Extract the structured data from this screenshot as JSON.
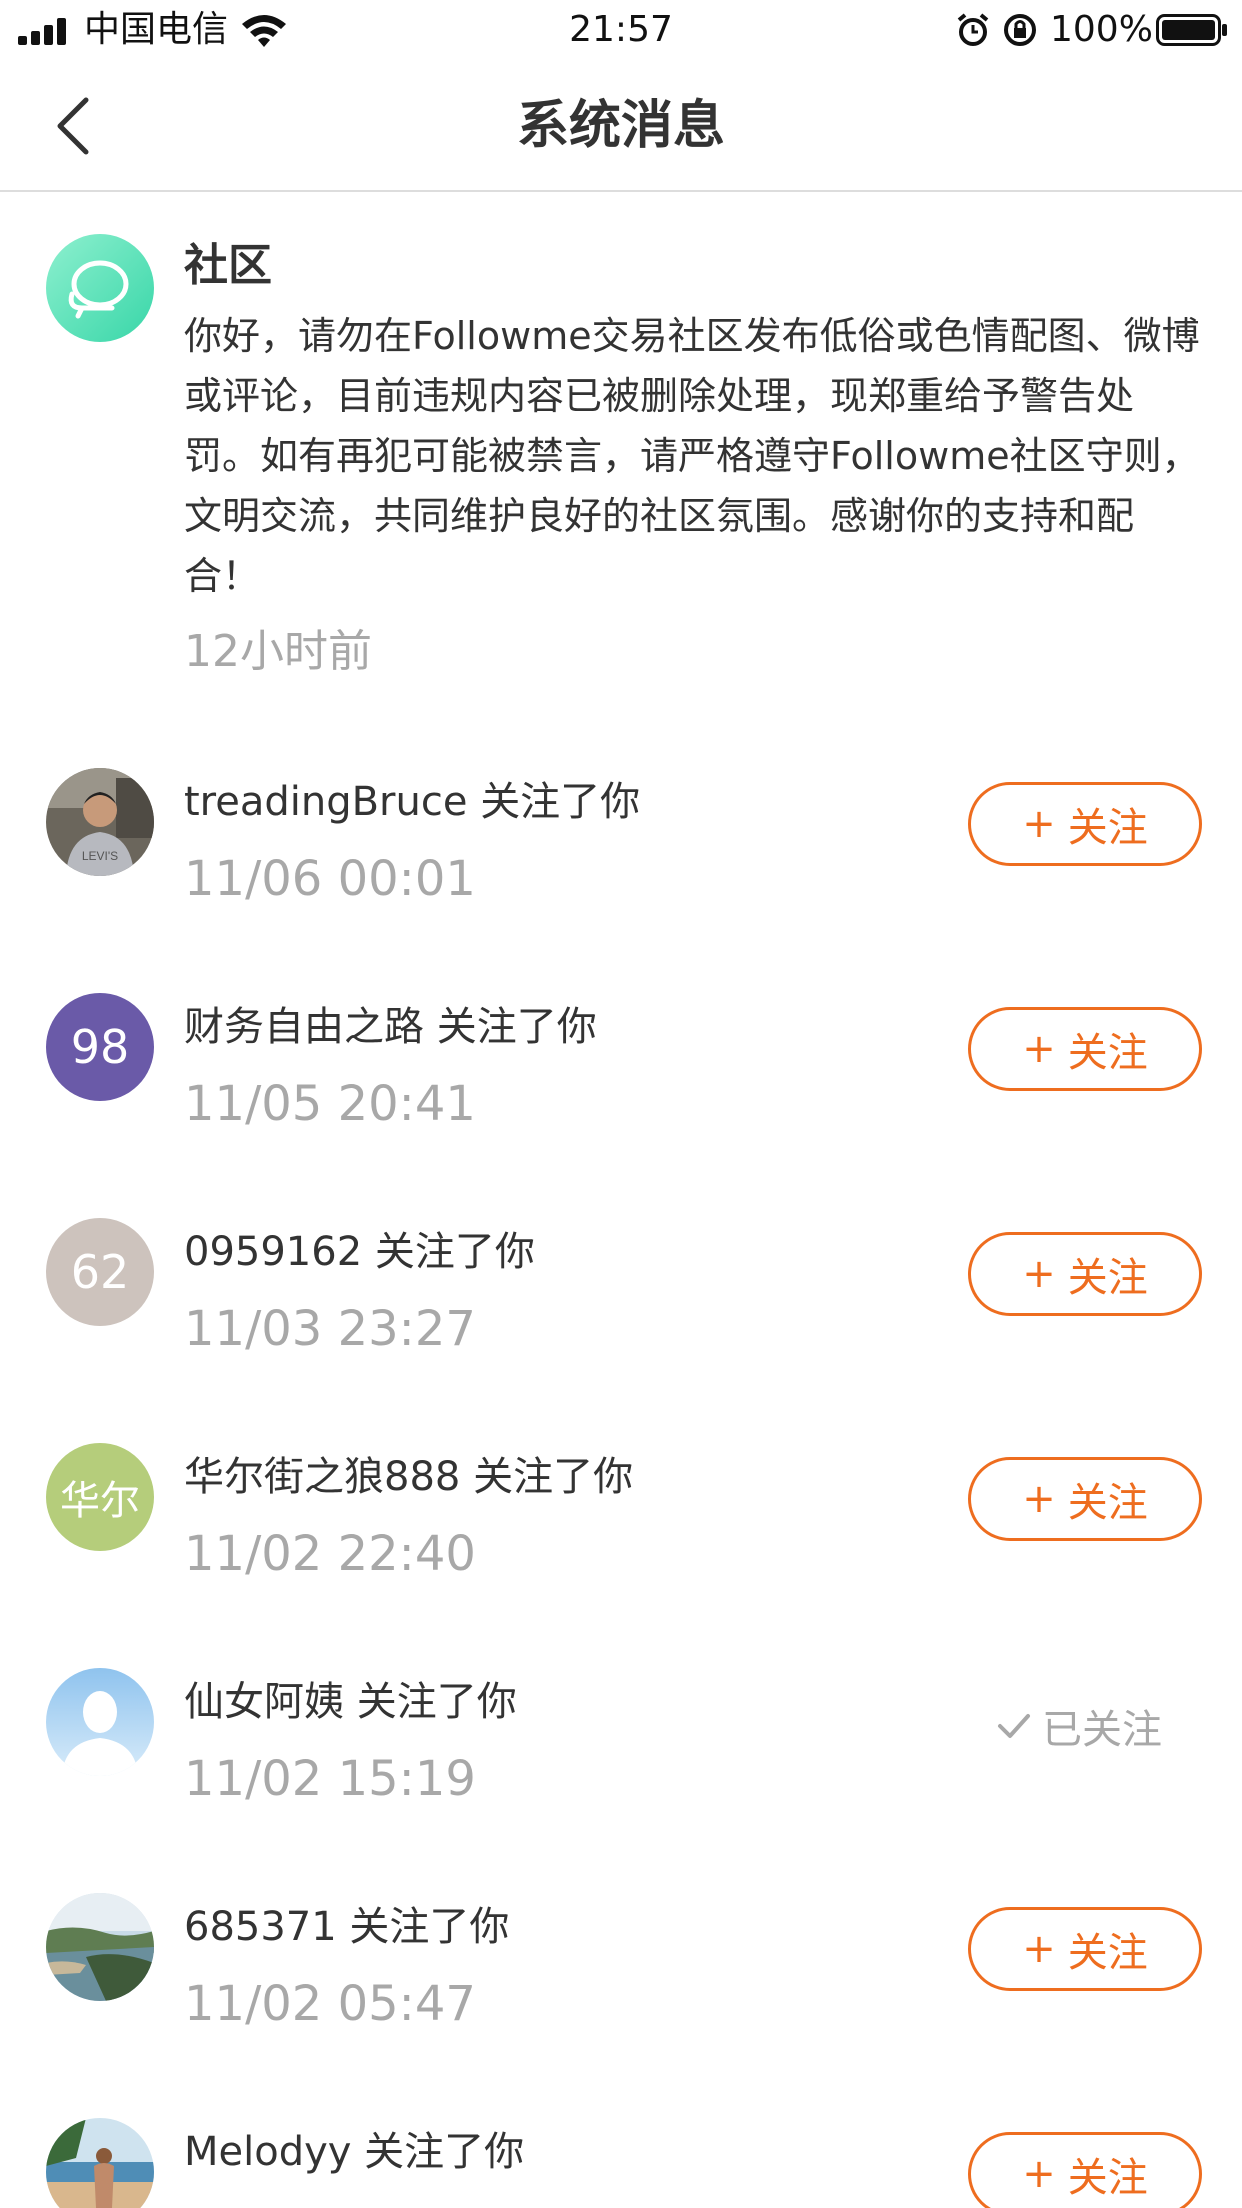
{
  "status_bar": {
    "carrier": "中国电信",
    "time": "21:57",
    "battery_percent": "100%"
  },
  "nav": {
    "title": "系统消息",
    "back_icon": "chevron-left-icon"
  },
  "system_message": {
    "sender": "社区",
    "body": "你好，请勿在Followme交易社区发布低俗或色情配图、微博或评论，目前违规内容已被删除处理，现郑重给予警告处罚。如有再犯可能被禁言，请严格遵守Followme社区守则，文明交流，共同维护良好的社区氛围。感谢你的支持和配合！",
    "time": "12小时前",
    "icon": "community-chat-icon"
  },
  "follow_suffix": "关注了你",
  "follow_button_label": "关注",
  "followed_label": "已关注",
  "colors": {
    "accent": "#ee6d1f",
    "muted": "#a8a8a8"
  },
  "notifications": [
    {
      "name": "treadingBruce",
      "time": "11/06 00:01",
      "avatar_type": "photo-person",
      "followed": false
    },
    {
      "name": "财务自由之路",
      "time": "11/05 20:41",
      "avatar_type": "text",
      "avatar_text": "98",
      "avatar_color": "#6a5aa8",
      "followed": false
    },
    {
      "name": "0959162",
      "time": "11/03 23:27",
      "avatar_type": "text",
      "avatar_text": "62",
      "avatar_color": "#cdc3bd",
      "followed": false
    },
    {
      "name": "华尔街之狼888",
      "time": "11/02 22:40",
      "avatar_type": "text",
      "avatar_text": "华尔",
      "avatar_color": "#b5cd7b",
      "followed": false
    },
    {
      "name": "仙女阿姨",
      "time": "11/02 15:19",
      "avatar_type": "default-silhouette",
      "followed": true
    },
    {
      "name": "685371",
      "time": "11/02 05:47",
      "avatar_type": "photo-landscape",
      "followed": false
    },
    {
      "name": "Melodyy",
      "time": "",
      "avatar_type": "photo-beach",
      "followed": false
    }
  ]
}
